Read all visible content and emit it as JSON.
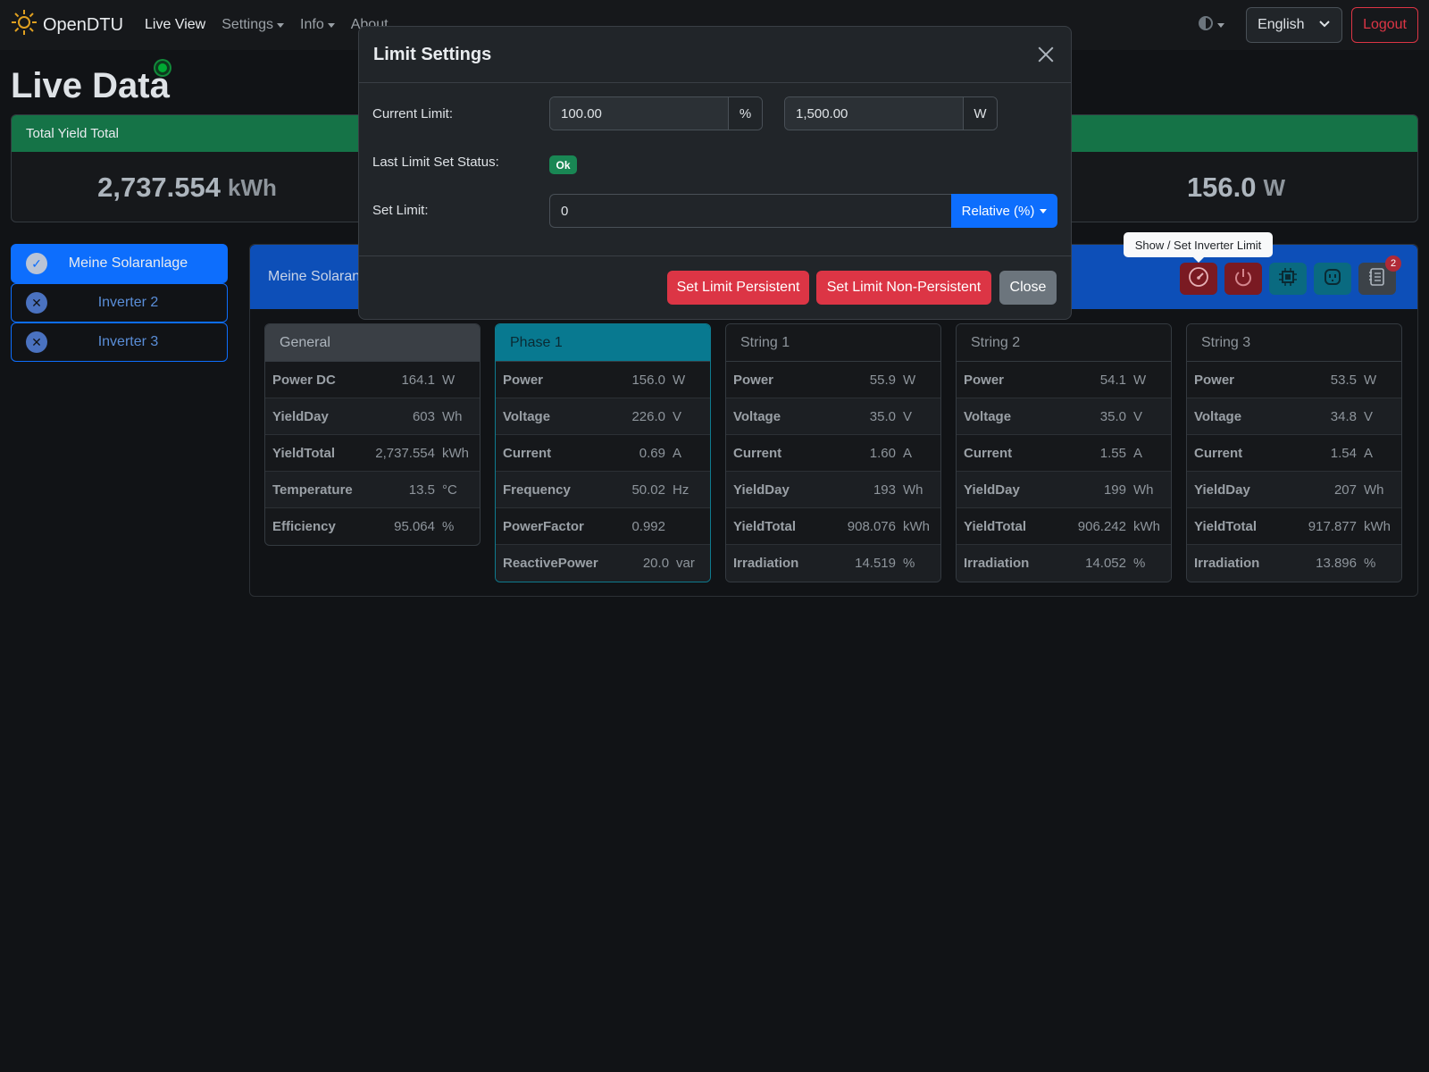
{
  "navbar": {
    "brand": "OpenDTU",
    "links": [
      {
        "label": "Live View",
        "active": true,
        "dropdown": false
      },
      {
        "label": "Settings",
        "active": false,
        "dropdown": true
      },
      {
        "label": "Info",
        "active": false,
        "dropdown": true
      },
      {
        "label": "About",
        "active": false,
        "dropdown": false
      }
    ],
    "language": "English",
    "logout_label": "Logout"
  },
  "page": {
    "title": "Live Data"
  },
  "totals": [
    {
      "label": "Total Yield Total",
      "value": "2,737.554",
      "unit": "kWh"
    },
    {
      "value": "156.0",
      "unit": "W"
    }
  ],
  "inverters": [
    {
      "label": "Meine Solaranlage",
      "status": "ok"
    },
    {
      "label": "Inverter 2",
      "status": "error"
    },
    {
      "label": "Inverter 3",
      "status": "error"
    }
  ],
  "inverter_panel": {
    "title": "Meine Solaranlage",
    "event_count": "2",
    "tooltip": "Show / Set Inverter Limit"
  },
  "cards": [
    {
      "title": "General",
      "rows": [
        {
          "k": "Power DC",
          "v": "164.1",
          "u": "W"
        },
        {
          "k": "YieldDay",
          "v": "603",
          "u": "Wh"
        },
        {
          "k": "YieldTotal",
          "v": "2,737.554",
          "u": "kWh"
        },
        {
          "k": "Temperature",
          "v": "13.5",
          "u": "°C"
        },
        {
          "k": "Efficiency",
          "v": "95.064",
          "u": "%"
        }
      ]
    },
    {
      "title": "Phase 1",
      "rows": [
        {
          "k": "Power",
          "v": "156.0",
          "u": "W"
        },
        {
          "k": "Voltage",
          "v": "226.0",
          "u": "V"
        },
        {
          "k": "Current",
          "v": "0.69",
          "u": "A"
        },
        {
          "k": "Frequency",
          "v": "50.02",
          "u": "Hz"
        },
        {
          "k": "PowerFactor",
          "v": "0.992",
          "u": ""
        },
        {
          "k": "ReactivePower",
          "v": "20.0",
          "u": "var"
        }
      ]
    },
    {
      "title": "String 1",
      "rows": [
        {
          "k": "Power",
          "v": "55.9",
          "u": "W"
        },
        {
          "k": "Voltage",
          "v": "35.0",
          "u": "V"
        },
        {
          "k": "Current",
          "v": "1.60",
          "u": "A"
        },
        {
          "k": "YieldDay",
          "v": "193",
          "u": "Wh"
        },
        {
          "k": "YieldTotal",
          "v": "908.076",
          "u": "kWh"
        },
        {
          "k": "Irradiation",
          "v": "14.519",
          "u": "%"
        }
      ]
    },
    {
      "title": "String 2",
      "rows": [
        {
          "k": "Power",
          "v": "54.1",
          "u": "W"
        },
        {
          "k": "Voltage",
          "v": "35.0",
          "u": "V"
        },
        {
          "k": "Current",
          "v": "1.55",
          "u": "A"
        },
        {
          "k": "YieldDay",
          "v": "199",
          "u": "Wh"
        },
        {
          "k": "YieldTotal",
          "v": "906.242",
          "u": "kWh"
        },
        {
          "k": "Irradiation",
          "v": "14.052",
          "u": "%"
        }
      ]
    },
    {
      "title": "String 3",
      "rows": [
        {
          "k": "Power",
          "v": "53.5",
          "u": "W"
        },
        {
          "k": "Voltage",
          "v": "34.8",
          "u": "V"
        },
        {
          "k": "Current",
          "v": "1.54",
          "u": "A"
        },
        {
          "k": "YieldDay",
          "v": "207",
          "u": "Wh"
        },
        {
          "k": "YieldTotal",
          "v": "917.877",
          "u": "kWh"
        },
        {
          "k": "Irradiation",
          "v": "13.896",
          "u": "%"
        }
      ]
    }
  ],
  "modal": {
    "title": "Limit Settings",
    "current_limit_label": "Current Limit:",
    "current_limit_percent": "100.00",
    "percent_unit": "%",
    "current_limit_watt": "1,500.00",
    "watt_unit": "W",
    "status_label": "Last Limit Set Status:",
    "status_value": "Ok",
    "set_limit_label": "Set Limit:",
    "set_limit_value": "0",
    "limit_type": "Relative (%)",
    "btn_persistent": "Set Limit Persistent",
    "btn_non_persistent": "Set Limit Non-Persistent",
    "btn_close": "Close"
  }
}
